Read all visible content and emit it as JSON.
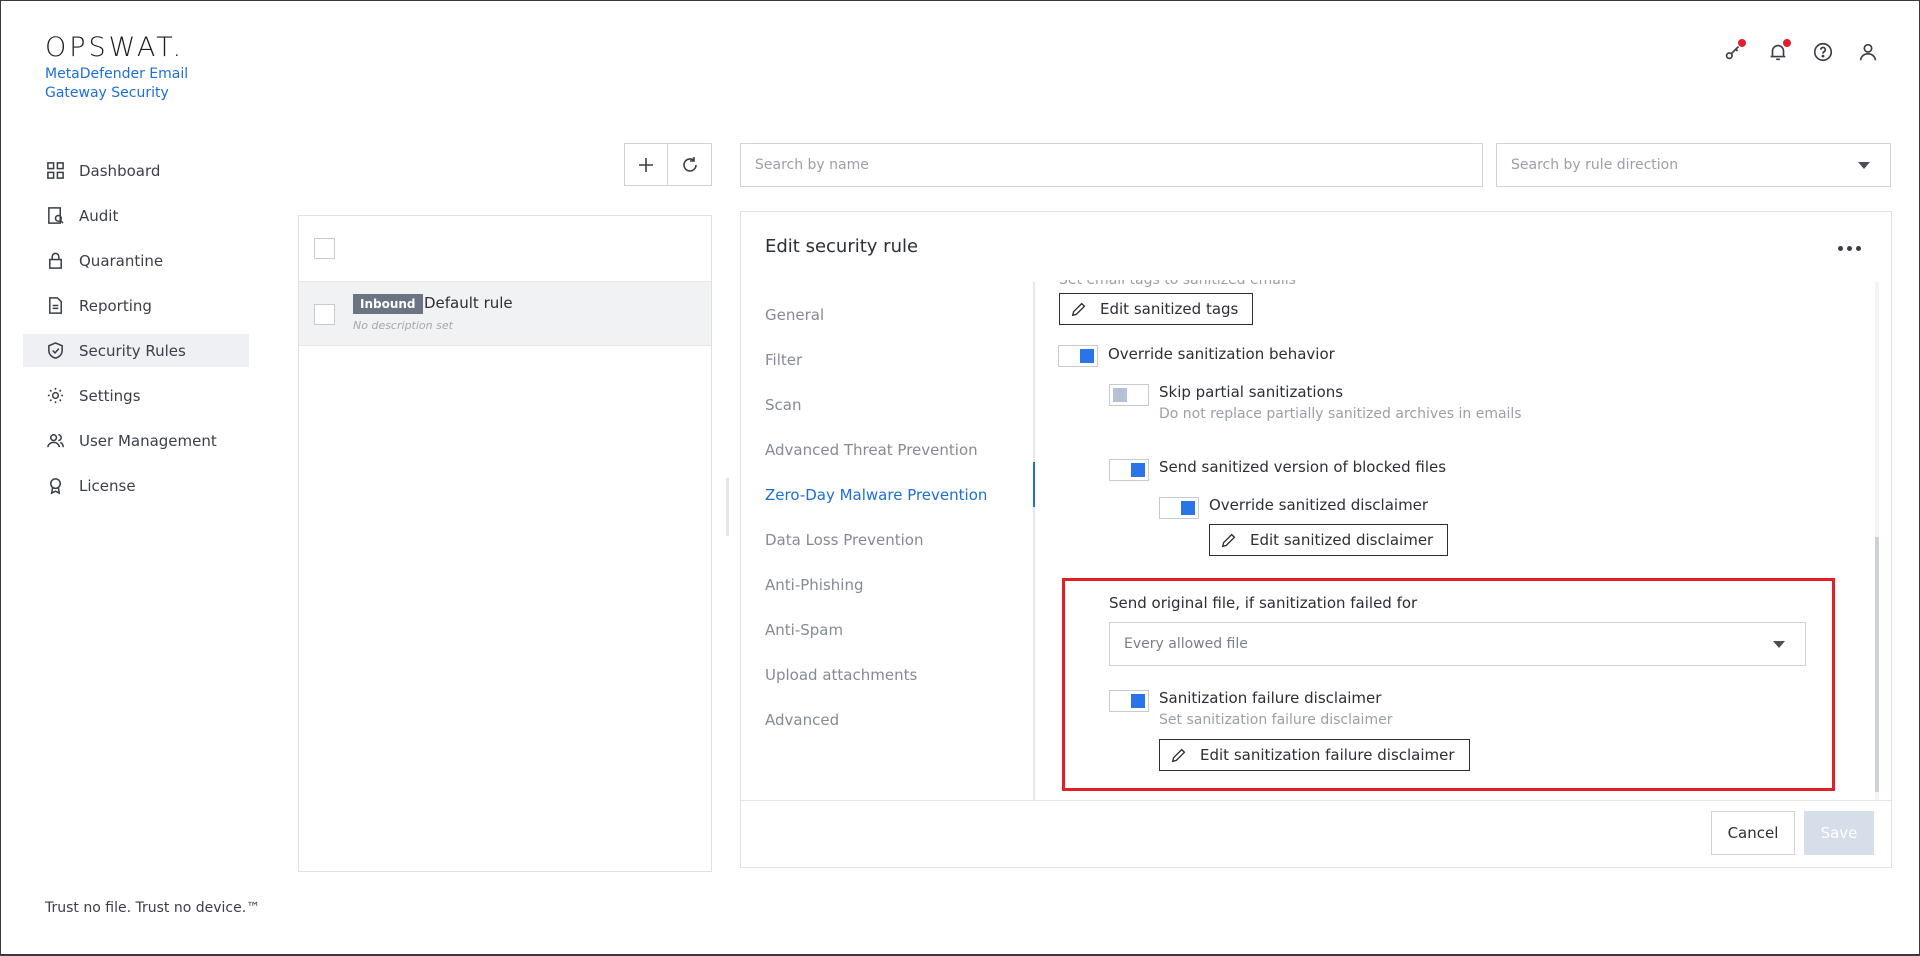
{
  "brand": {
    "logo": "OPSWAT.",
    "product_line1": "MetaDefender Email",
    "product_line2": "Gateway Security"
  },
  "header_icons": [
    "key-icon",
    "bell-icon",
    "help-icon",
    "user-icon"
  ],
  "sidebar": {
    "items": [
      {
        "label": "Dashboard",
        "icon": "dashboard-icon"
      },
      {
        "label": "Audit",
        "icon": "audit-icon"
      },
      {
        "label": "Quarantine",
        "icon": "lock-icon"
      },
      {
        "label": "Reporting",
        "icon": "report-icon"
      },
      {
        "label": "Security Rules",
        "icon": "shield-check-icon",
        "active": true
      },
      {
        "label": "Settings",
        "icon": "gear-icon"
      },
      {
        "label": "User Management",
        "icon": "users-icon"
      },
      {
        "label": "License",
        "icon": "award-icon"
      }
    ],
    "footer": "Trust no file. Trust no device.™"
  },
  "search": {
    "name_placeholder": "Search by name",
    "direction_placeholder": "Search by rule direction"
  },
  "rules": [
    {
      "badge": "Inbound",
      "name": "Default rule",
      "description": "No description set"
    }
  ],
  "edit": {
    "title": "Edit security rule",
    "tabs": [
      "General",
      "Filter",
      "Scan",
      "Advanced Threat Prevention",
      "Zero-Day Malware Prevention",
      "Data Loss Prevention",
      "Anti-Phishing",
      "Anti-Spam",
      "Upload attachments",
      "Advanced"
    ],
    "active_tab": "Zero-Day Malware Prevention",
    "content": {
      "cut_text": "Set email tags to sanitized emails",
      "edit_tags_btn": "Edit sanitized tags",
      "override_behavior": "Override sanitization behavior",
      "skip_partial": "Skip partial sanitizations",
      "skip_partial_sub": "Do not replace partially sanitized archives in emails",
      "send_sanitized": "Send sanitized version of blocked files",
      "override_disclaimer": "Override sanitized disclaimer",
      "edit_disclaimer_btn": "Edit sanitized disclaimer",
      "send_original_label": "Send original file, if sanitization failed for",
      "send_original_value": "Every allowed file",
      "failure_disclaimer": "Sanitization failure disclaimer",
      "failure_disclaimer_sub": "Set sanitization failure disclaimer",
      "edit_failure_btn": "Edit sanitization failure disclaimer"
    },
    "cancel": "Cancel",
    "save": "Save"
  },
  "colors": {
    "accent": "#1d6fd6",
    "toggle_on": "#2a74e8",
    "highlight": "#e31e24"
  }
}
